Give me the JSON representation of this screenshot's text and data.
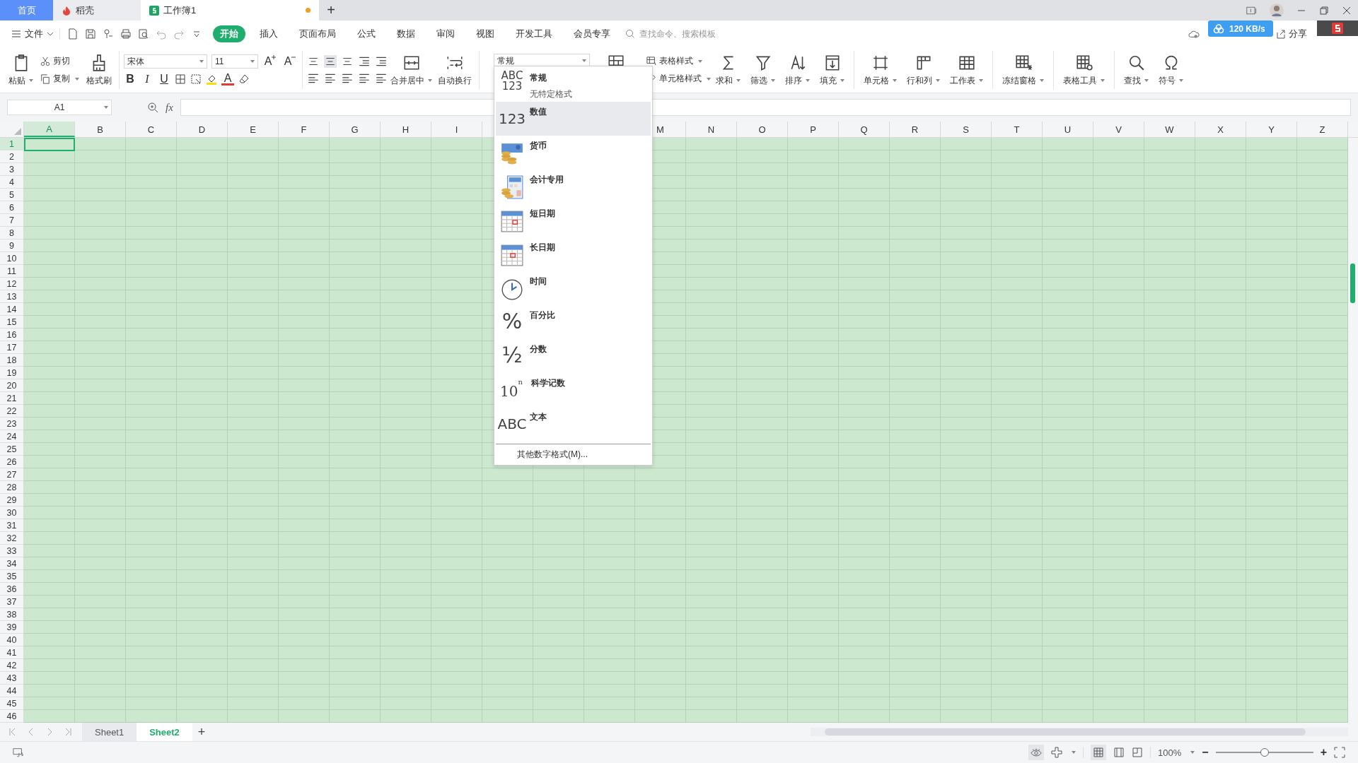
{
  "tabs": [
    {
      "label": "首页",
      "kind": "home",
      "selected": false
    },
    {
      "label": "稻壳",
      "kind": "docer",
      "selected": false
    },
    {
      "label": "工作簿1",
      "kind": "sheet",
      "selected": true,
      "modified": true
    }
  ],
  "new_tab": "+",
  "menu": {
    "file": "文件",
    "items": [
      {
        "label": "开始",
        "selected": true
      },
      {
        "label": "插入",
        "selected": false
      },
      {
        "label": "页面布局",
        "selected": false
      },
      {
        "label": "公式",
        "selected": false
      },
      {
        "label": "数据",
        "selected": false
      },
      {
        "label": "审阅",
        "selected": false
      },
      {
        "label": "视图",
        "selected": false
      },
      {
        "label": "开发工具",
        "selected": false
      },
      {
        "label": "会员专享",
        "selected": false
      }
    ],
    "search": {
      "placeholder": "查找命令、搜索模板"
    },
    "speed": "120 KB/s",
    "share": "分享"
  },
  "ribbon": {
    "paste": "粘贴",
    "cut": "剪切",
    "copy": "复制",
    "painter": "格式刷",
    "font": "宋体",
    "font_size": "11",
    "grow": "A",
    "shrink": "A",
    "bold": "B",
    "italic": "I",
    "underline": "U",
    "font_color": "A",
    "merge": "合并居中",
    "wrap": "自动换行",
    "number_format": "常规",
    "table_style": "表格样式",
    "cell_style": "单元格样式",
    "tools": [
      {
        "label": "求和"
      },
      {
        "label": "筛选"
      },
      {
        "label": "排序"
      },
      {
        "label": "填充"
      },
      {
        "label": "单元格"
      },
      {
        "label": "行和列"
      },
      {
        "label": "工作表"
      },
      {
        "label": "冻结窗格"
      },
      {
        "label": "表格工具"
      },
      {
        "label": "查找"
      },
      {
        "label": "符号"
      }
    ]
  },
  "formula_bar": {
    "name_box": "A1",
    "fx": "fx"
  },
  "columns_left": [
    {
      "label": "A",
      "selected": true
    },
    {
      "label": "B",
      "selected": false
    },
    {
      "label": "C",
      "selected": false
    },
    {
      "label": "D",
      "selected": false
    },
    {
      "label": "E",
      "selected": false
    },
    {
      "label": "F",
      "selected": false
    },
    {
      "label": "G",
      "selected": false
    },
    {
      "label": "H",
      "selected": false
    },
    {
      "label": "I",
      "selected": false
    }
  ],
  "columns_right": [
    {
      "label": "M",
      "selected": false
    },
    {
      "label": "N",
      "selected": false
    },
    {
      "label": "O",
      "selected": false
    },
    {
      "label": "P",
      "selected": false
    },
    {
      "label": "Q",
      "selected": false
    },
    {
      "label": "R",
      "selected": false
    },
    {
      "label": "S",
      "selected": false
    },
    {
      "label": "T",
      "selected": false
    },
    {
      "label": "U",
      "selected": false
    },
    {
      "label": "V",
      "selected": false
    },
    {
      "label": "W",
      "selected": false
    },
    {
      "label": "X",
      "selected": false
    },
    {
      "label": "Y",
      "selected": false
    },
    {
      "label": "Z",
      "selected": false
    }
  ],
  "rows": [
    {
      "label": "1",
      "selected": true
    },
    {
      "label": "2",
      "selected": false
    },
    {
      "label": "3",
      "selected": false
    },
    {
      "label": "4",
      "selected": false
    },
    {
      "label": "5",
      "selected": false
    },
    {
      "label": "6",
      "selected": false
    },
    {
      "label": "7",
      "selected": false
    },
    {
      "label": "8",
      "selected": false
    },
    {
      "label": "9",
      "selected": false
    },
    {
      "label": "10",
      "selected": false
    },
    {
      "label": "11",
      "selected": false
    },
    {
      "label": "12",
      "selected": false
    },
    {
      "label": "13",
      "selected": false
    },
    {
      "label": "14",
      "selected": false
    },
    {
      "label": "15",
      "selected": false
    },
    {
      "label": "16",
      "selected": false
    },
    {
      "label": "17",
      "selected": false
    },
    {
      "label": "18",
      "selected": false
    },
    {
      "label": "19",
      "selected": false
    },
    {
      "label": "20",
      "selected": false
    },
    {
      "label": "21",
      "selected": false
    },
    {
      "label": "22",
      "selected": false
    },
    {
      "label": "23",
      "selected": false
    },
    {
      "label": "24",
      "selected": false
    },
    {
      "label": "25",
      "selected": false
    },
    {
      "label": "26",
      "selected": false
    },
    {
      "label": "27",
      "selected": false
    },
    {
      "label": "28",
      "selected": false
    },
    {
      "label": "29",
      "selected": false
    },
    {
      "label": "30",
      "selected": false
    },
    {
      "label": "31",
      "selected": false
    },
    {
      "label": "32",
      "selected": false
    },
    {
      "label": "33",
      "selected": false
    },
    {
      "label": "34",
      "selected": false
    },
    {
      "label": "35",
      "selected": false
    },
    {
      "label": "36",
      "selected": false
    },
    {
      "label": "37",
      "selected": false
    },
    {
      "label": "38",
      "selected": false
    },
    {
      "label": "39",
      "selected": false
    },
    {
      "label": "40",
      "selected": false
    },
    {
      "label": "41",
      "selected": false
    },
    {
      "label": "42",
      "selected": false
    },
    {
      "label": "43",
      "selected": false
    },
    {
      "label": "44",
      "selected": false
    },
    {
      "label": "45",
      "selected": false
    },
    {
      "label": "46",
      "selected": false
    }
  ],
  "format_menu": {
    "items": [
      {
        "kind": "glyph",
        "glyph": [
          "ABC",
          "123"
        ],
        "title": "常规",
        "subtitle": "无特定格式",
        "selected": false
      },
      {
        "kind": "glyph",
        "glyph": [
          "123"
        ],
        "title": "数值",
        "selected": true
      },
      {
        "kind": "currency",
        "title": "货币",
        "selected": false
      },
      {
        "kind": "accounting",
        "title": "会计专用",
        "selected": false
      },
      {
        "kind": "calendar",
        "title": "短日期",
        "selected": false
      },
      {
        "kind": "calendar",
        "title": "长日期",
        "selected": false
      },
      {
        "kind": "clock",
        "title": "时间",
        "selected": false
      },
      {
        "kind": "glyph",
        "glyph": [
          "%"
        ],
        "title": "百分比",
        "selected": false
      },
      {
        "kind": "glyph",
        "glyph": [
          "½"
        ],
        "title": "分数",
        "selected": false
      },
      {
        "kind": "power",
        "glyph": [
          "10",
          "n"
        ],
        "title": "科学记数",
        "selected": false
      },
      {
        "kind": "glyph",
        "glyph": [
          "ABC"
        ],
        "title": "文本",
        "selected": false
      }
    ],
    "more": "其他数字格式(M)..."
  },
  "sheets": [
    {
      "label": "Sheet1",
      "selected": false
    },
    {
      "label": "Sheet2",
      "selected": true
    }
  ],
  "add_sheet": "+",
  "status_bar": {
    "zoom": "100%",
    "zoom_out": "−",
    "zoom_in": "+",
    "zoom_slider": {
      "level": 0.5
    }
  }
}
